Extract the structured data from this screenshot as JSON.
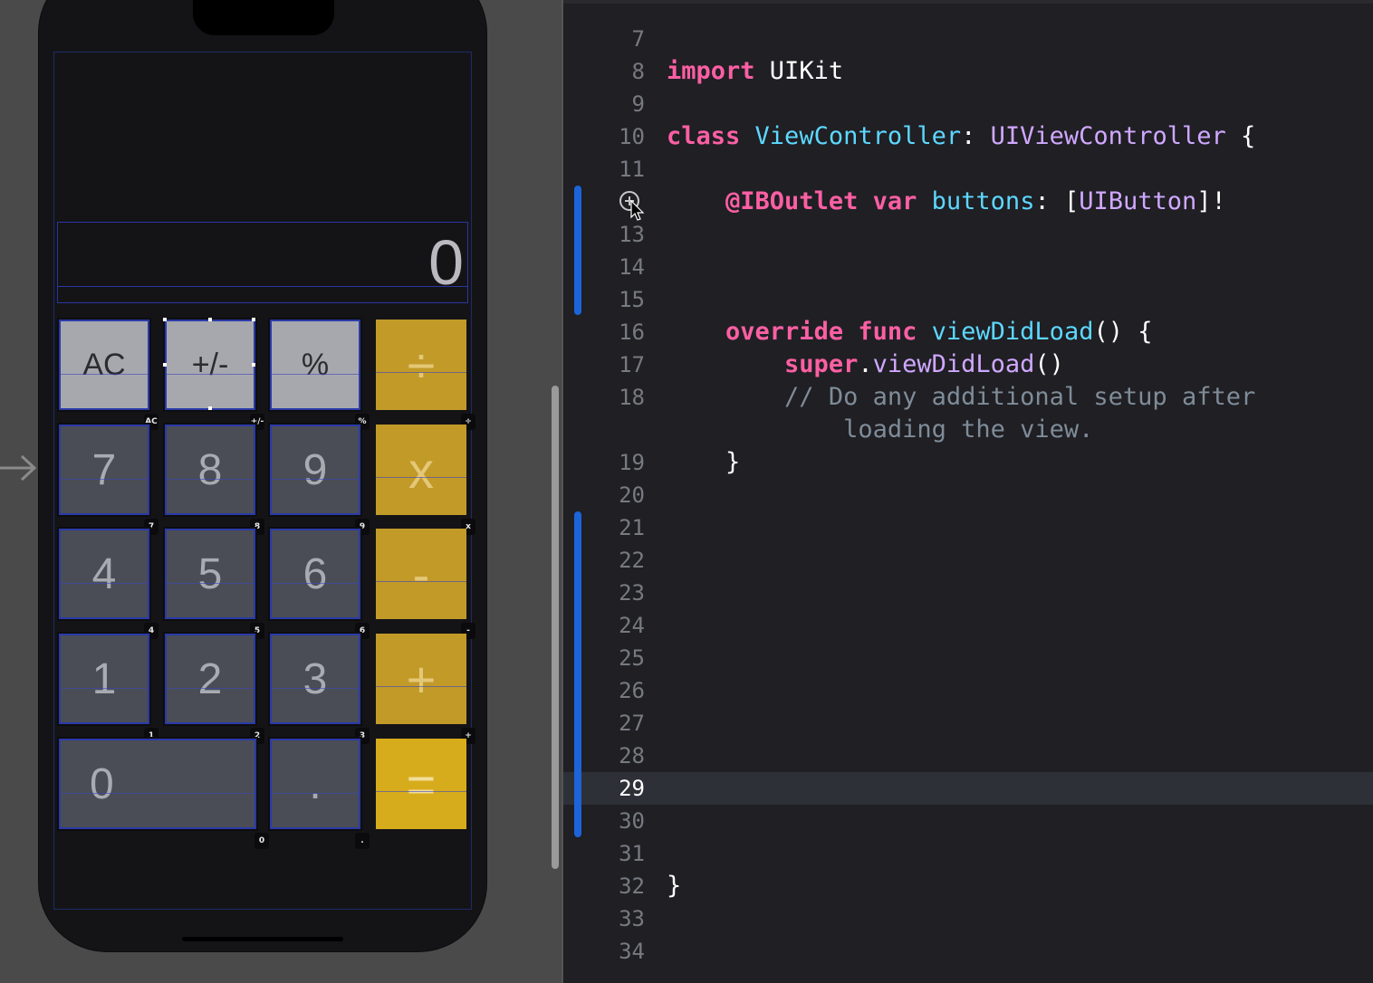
{
  "calculator": {
    "display": "0",
    "keys": [
      {
        "label": "AC",
        "type": "func",
        "tag": "AC"
      },
      {
        "label": "+/-",
        "type": "func",
        "tag": "+/-"
      },
      {
        "label": "%",
        "type": "func",
        "tag": "%"
      },
      {
        "label": "÷",
        "type": "op",
        "tag": "÷"
      },
      {
        "label": "7",
        "type": "num",
        "tag": "7"
      },
      {
        "label": "8",
        "type": "num",
        "tag": "8"
      },
      {
        "label": "9",
        "type": "num",
        "tag": "9"
      },
      {
        "label": "x",
        "type": "op",
        "tag": "x"
      },
      {
        "label": "4",
        "type": "num",
        "tag": "4"
      },
      {
        "label": "5",
        "type": "num",
        "tag": "5"
      },
      {
        "label": "6",
        "type": "num",
        "tag": "6"
      },
      {
        "label": "-",
        "type": "op",
        "tag": "-"
      },
      {
        "label": "1",
        "type": "num",
        "tag": "1"
      },
      {
        "label": "2",
        "type": "num",
        "tag": "2"
      },
      {
        "label": "3",
        "type": "num",
        "tag": "3"
      },
      {
        "label": "+",
        "type": "op",
        "tag": "+"
      },
      {
        "label": "0",
        "type": "num",
        "tag": "0"
      },
      {
        "label": ".",
        "type": "num",
        "tag": "."
      },
      {
        "label": "=",
        "type": "op",
        "tag": ""
      }
    ]
  },
  "editor": {
    "current_line": "29",
    "lines": [
      {
        "num": "7",
        "code": []
      },
      {
        "num": "8",
        "code": [
          [
            "kw",
            "import"
          ],
          [
            "plain",
            " UIKit"
          ]
        ]
      },
      {
        "num": "9",
        "code": []
      },
      {
        "num": "10",
        "code": [
          [
            "kw",
            "class"
          ],
          [
            "plain",
            " "
          ],
          [
            "type",
            "ViewController"
          ],
          [
            "plain",
            ": "
          ],
          [
            "sys",
            "UIViewController"
          ],
          [
            "plain",
            " {"
          ]
        ]
      },
      {
        "num": "11",
        "code": []
      },
      {
        "num": "",
        "code": [
          [
            "plain",
            "    "
          ],
          [
            "kw",
            "@IBOutlet"
          ],
          [
            "plain",
            " "
          ],
          [
            "kw",
            "var"
          ],
          [
            "plain",
            " "
          ],
          [
            "type",
            "buttons"
          ],
          [
            "plain",
            ": ["
          ],
          [
            "sys",
            "UIButton"
          ],
          [
            "plain",
            "]!"
          ]
        ]
      },
      {
        "num": "13",
        "code": []
      },
      {
        "num": "14",
        "code": []
      },
      {
        "num": "15",
        "code": []
      },
      {
        "num": "16",
        "code": [
          [
            "plain",
            "    "
          ],
          [
            "kw",
            "override"
          ],
          [
            "plain",
            " "
          ],
          [
            "kw",
            "func"
          ],
          [
            "plain",
            " "
          ],
          [
            "type",
            "viewDidLoad"
          ],
          [
            "plain",
            "() {"
          ]
        ]
      },
      {
        "num": "17",
        "code": [
          [
            "plain",
            "        "
          ],
          [
            "kw",
            "super"
          ],
          [
            "plain",
            "."
          ],
          [
            "sys",
            "viewDidLoad"
          ],
          [
            "plain",
            "()"
          ]
        ]
      },
      {
        "num": "18",
        "code": [
          [
            "plain",
            "        "
          ],
          [
            "cmt",
            "// Do any additional setup after"
          ]
        ]
      },
      {
        "num": "",
        "code": [
          [
            "plain",
            "            "
          ],
          [
            "cmt",
            "loading the view."
          ]
        ]
      },
      {
        "num": "19",
        "code": [
          [
            "plain",
            "    }"
          ]
        ]
      },
      {
        "num": "20",
        "code": []
      },
      {
        "num": "21",
        "code": []
      },
      {
        "num": "22",
        "code": []
      },
      {
        "num": "23",
        "code": []
      },
      {
        "num": "24",
        "code": []
      },
      {
        "num": "25",
        "code": []
      },
      {
        "num": "26",
        "code": []
      },
      {
        "num": "27",
        "code": []
      },
      {
        "num": "28",
        "code": []
      },
      {
        "num": "29",
        "code": []
      },
      {
        "num": "30",
        "code": []
      },
      {
        "num": "31",
        "code": []
      },
      {
        "num": "32",
        "code": [
          [
            "plain",
            "}"
          ]
        ]
      },
      {
        "num": "33",
        "code": []
      },
      {
        "num": "34",
        "code": []
      }
    ]
  },
  "colors": {
    "keyword": "#fc5fa3",
    "type": "#5dd8ff",
    "system_type": "#d0a8ff",
    "comment": "#7f8c98",
    "operator_key": "#c29a28",
    "change_bar": "#1c64d8"
  }
}
